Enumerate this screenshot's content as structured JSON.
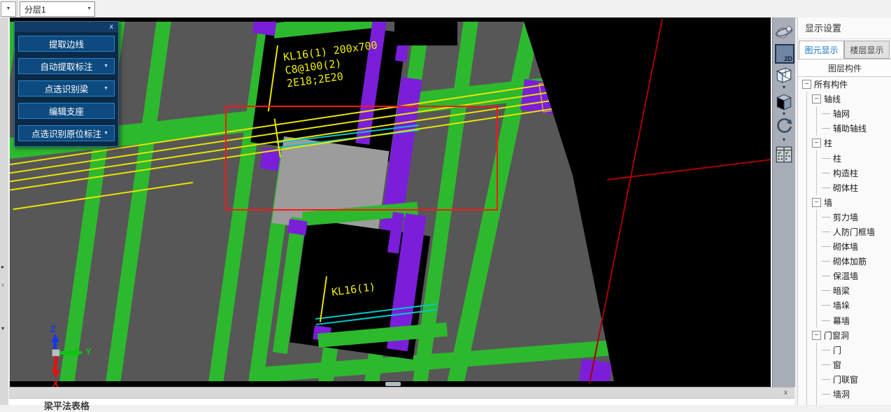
{
  "colors": {
    "wall_green": "#2db92d",
    "column_purple": "#7b1ed9",
    "highlight_yellow": "#e8e400",
    "axis_red": "#a80000",
    "selection_red": "#ff1414",
    "beam_edge_cyan": "#00c8c8"
  },
  "top_bar": {
    "layer_selector_value": "分层1"
  },
  "floating_panel": {
    "close_label": "x",
    "buttons": [
      {
        "label": "提取边线",
        "has_dropdown": false
      },
      {
        "label": "自动提取标注",
        "has_dropdown": true
      },
      {
        "label": "点选识别梁",
        "has_dropdown": true
      },
      {
        "label": "编辑支座",
        "has_dropdown": false
      },
      {
        "label": "点选识别原位标注",
        "has_dropdown": true
      }
    ]
  },
  "canvas": {
    "beam_annotation": {
      "line1": "KL16(1) 200x700",
      "line2": "C8@100(2)",
      "line3": "2E18;2E20"
    },
    "beam_annotation_2": "KL16(1)",
    "axis_labels": {
      "x": "X",
      "y": "Y",
      "z": "Z"
    }
  },
  "right_toolbar": {
    "view_2d_label": "2D"
  },
  "sidebar": {
    "title": "显示设置",
    "tabs": [
      {
        "label": "图元显示",
        "active": true
      },
      {
        "label": "楼层显示",
        "active": false
      }
    ],
    "tree_header": "图层构件",
    "tree": [
      {
        "label": "所有构件",
        "level": 0,
        "expandable": true
      },
      {
        "label": "轴线",
        "level": 1,
        "expandable": true
      },
      {
        "label": "轴网",
        "level": 2,
        "expandable": false
      },
      {
        "label": "辅助轴线",
        "level": 2,
        "expandable": false
      },
      {
        "label": "柱",
        "level": 1,
        "expandable": true
      },
      {
        "label": "柱",
        "level": 2,
        "expandable": false
      },
      {
        "label": "构造柱",
        "level": 2,
        "expandable": false
      },
      {
        "label": "砌体柱",
        "level": 2,
        "expandable": false
      },
      {
        "label": "墙",
        "level": 1,
        "expandable": true
      },
      {
        "label": "剪力墙",
        "level": 2,
        "expandable": false
      },
      {
        "label": "人防门框墙",
        "level": 2,
        "expandable": false
      },
      {
        "label": "砌体墙",
        "level": 2,
        "expandable": false
      },
      {
        "label": "砌体加筋",
        "level": 2,
        "expandable": false
      },
      {
        "label": "保温墙",
        "level": 2,
        "expandable": false
      },
      {
        "label": "暗梁",
        "level": 2,
        "expandable": false
      },
      {
        "label": "墙垛",
        "level": 2,
        "expandable": false
      },
      {
        "label": "幕墙",
        "level": 2,
        "expandable": false
      },
      {
        "label": "门窗洞",
        "level": 1,
        "expandable": true
      },
      {
        "label": "门",
        "level": 2,
        "expandable": false
      },
      {
        "label": "窗",
        "level": 2,
        "expandable": false
      },
      {
        "label": "门联窗",
        "level": 2,
        "expandable": false
      },
      {
        "label": "墙洞",
        "level": 2,
        "expandable": false
      },
      {
        "label": "",
        "level": 2,
        "expandable": false
      }
    ]
  },
  "bottom_panel": {
    "title": "梁平法表格",
    "close_label": "x"
  }
}
